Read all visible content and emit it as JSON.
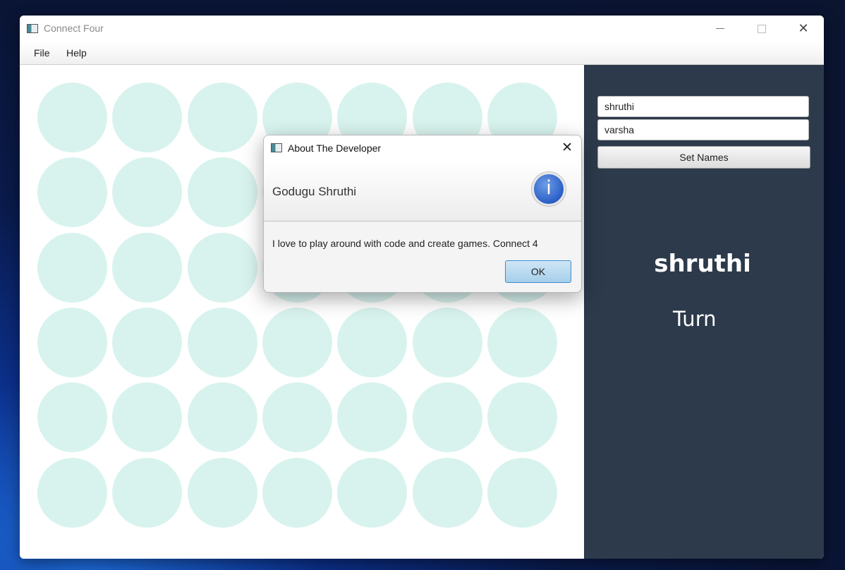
{
  "window": {
    "title": "Connect Four"
  },
  "menubar": {
    "items": [
      "File",
      "Help"
    ]
  },
  "board": {
    "rows": 6,
    "columns": 7,
    "empty_color": "#d8f3ee"
  },
  "side_panel": {
    "background": "#2c3a4b",
    "player1_input": "shruthi",
    "player2_input": "varsha",
    "set_names_label": "Set Names",
    "current_player": "shruthi",
    "turn_label": "Turn"
  },
  "dialog": {
    "title": "About The Developer",
    "heading": "Godugu Shruthi",
    "content": "I love to play around with code and create games. Connect 4",
    "ok_label": "OK",
    "icon": "info-icon",
    "icon_glyph": "i",
    "close_glyph": "✕"
  },
  "icons": {
    "app": "app-icon",
    "minimize": "minimize-icon",
    "maximize": "maximize-icon",
    "close": "close-icon",
    "close_glyph": "✕"
  }
}
